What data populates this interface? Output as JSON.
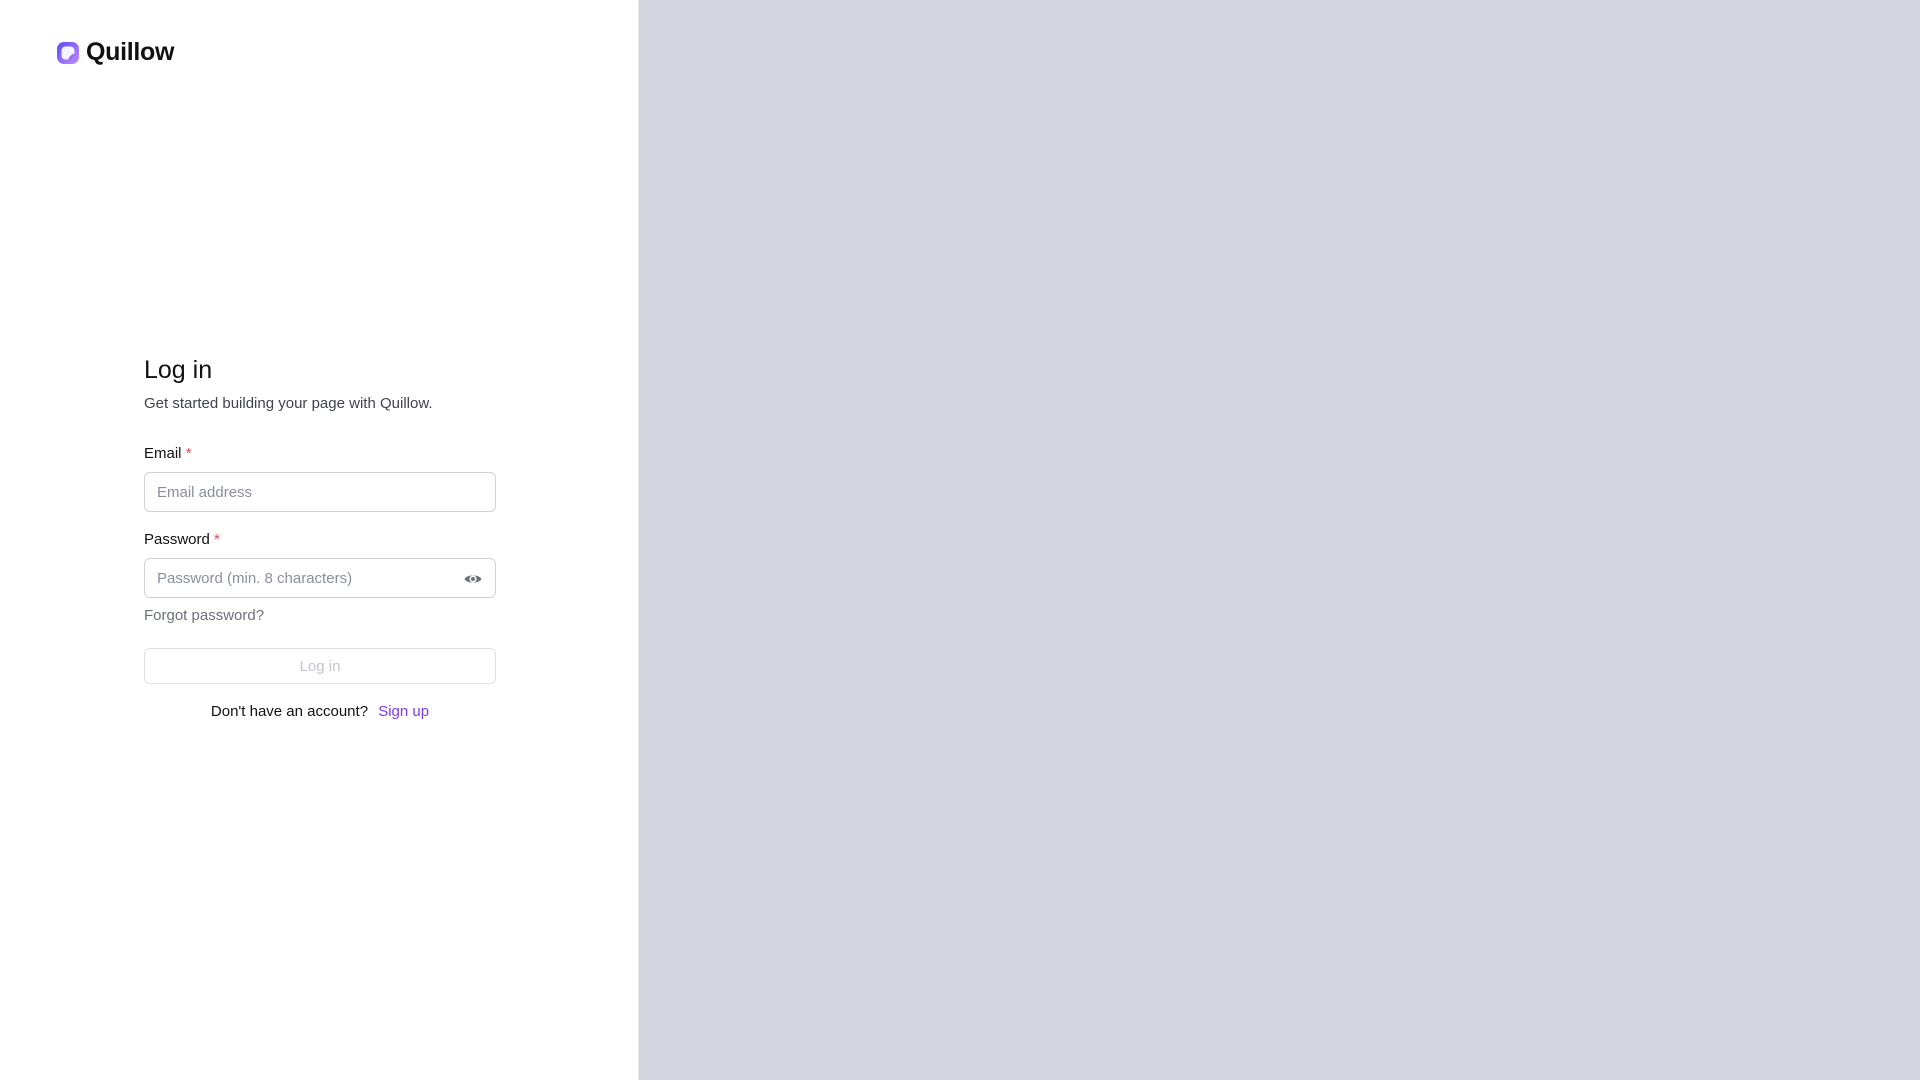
{
  "brand": {
    "name": "Quillow",
    "logo_icon": "quillow-logo-icon",
    "logo_gradient": [
      "#6b5cff",
      "#b07bff"
    ]
  },
  "login": {
    "title": "Log in",
    "subtitle": "Get started building your page with Quillow.",
    "email": {
      "label": "Email",
      "required_mark": "*",
      "value": "",
      "placeholder": "Email address"
    },
    "password": {
      "label": "Password",
      "required_mark": "*",
      "value": "",
      "placeholder": "Password (min. 8 characters)",
      "toggle_icon": "eye-icon"
    },
    "forgot_password": "Forgot password?",
    "submit_label": "Log in",
    "submit_disabled": true,
    "signup_prompt": "Don't have an account?",
    "signup_link": "Sign up"
  },
  "colors": {
    "accent": "#7c3aed",
    "required": "#e5484d",
    "right_panel_bg": "#d3d6df"
  }
}
